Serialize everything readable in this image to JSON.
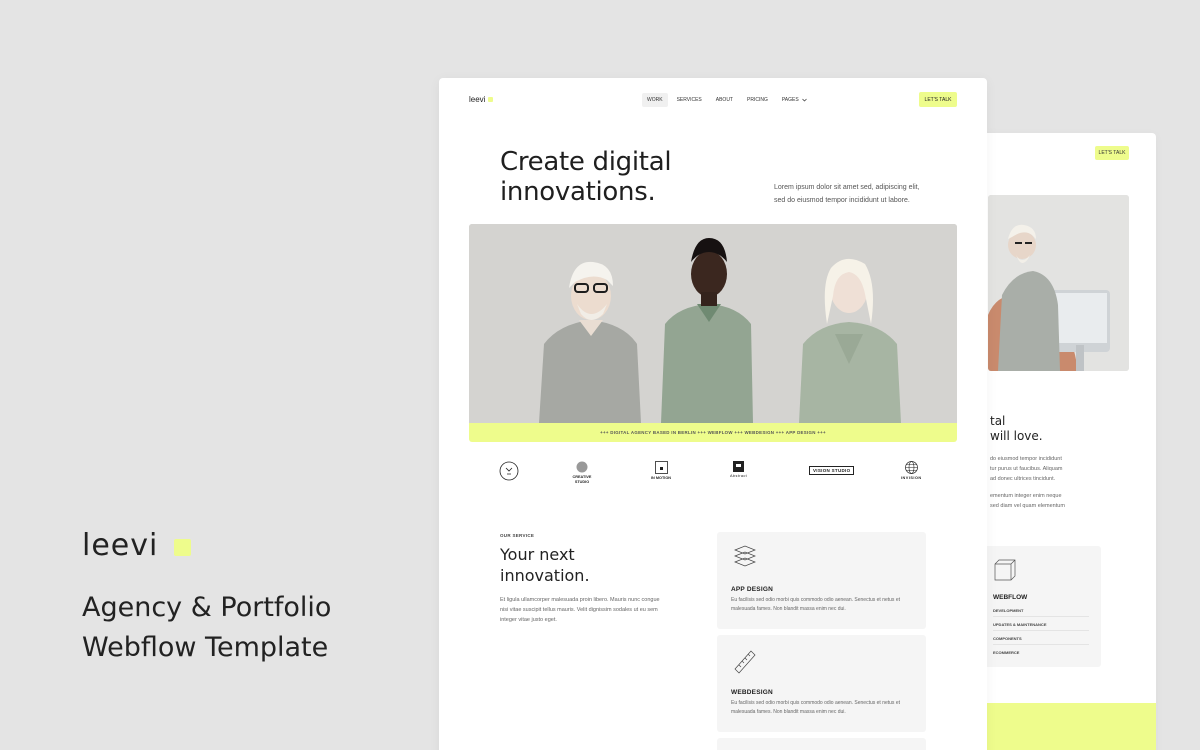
{
  "brand": {
    "name": "leevi",
    "tagline_line1": "Agency & Portfolio",
    "tagline_line2": "Webflow Template",
    "accent_color": "#eefc8c"
  },
  "nav": {
    "logo": "leevi",
    "items": [
      {
        "label": "WORK",
        "active": true
      },
      {
        "label": "SERVICES",
        "active": false
      },
      {
        "label": "ABOUT",
        "active": false
      },
      {
        "label": "PRICING",
        "active": false
      },
      {
        "label": "PAGES",
        "active": false,
        "dropdown": true
      }
    ],
    "cta": "LET'S TALK"
  },
  "hero": {
    "title_line1": "Create digital",
    "title_line2": "innovations.",
    "subtitle_line1": "Lorem ipsum dolor sit amet sed, adipiscing elit,",
    "subtitle_line2": "sed do eiusmod tempor incididunt ut labore.",
    "ticker": "+++ DIGITAL AGENCY BASED IN BERLIN +++ WEBFLOW +++ WEBDESIGN +++ APP DESIGN +++"
  },
  "logos": [
    {
      "label": "",
      "icon": "emblem-icon"
    },
    {
      "label": "CREATIVE STUDIO",
      "icon": "circle-logo-icon"
    },
    {
      "label": "IN MOTION",
      "icon": "square-frame-logo-icon"
    },
    {
      "label": "Abstract",
      "icon": "dark-square-logo-icon"
    },
    {
      "label": "VISION STUDIO",
      "icon": "vision-box-logo-icon"
    },
    {
      "label": "INVISION",
      "icon": "globe-logo-icon"
    }
  ],
  "services": {
    "label": "OUR SERVICE",
    "title_line1": "Your next",
    "title_line2": "innovation.",
    "text": "Et ligula ullamcorper malesuada proin libero. Mauris nunc congue nisi vitae suscipit tellus mauris. Velit dignissim sodales ut eu sem integer vitae justo eget.",
    "cards": [
      {
        "title": "APP DESIGN",
        "icon": "layers-icon",
        "desc": "Eu facilisis sed odio morbi quis commodo odio aenean. Senectus et netus et malesuada fames. Non blandit massa enim nec dui."
      },
      {
        "title": "WEBDESIGN",
        "icon": "ruler-icon",
        "desc": "Eu facilisis sed odio morbi quis commodo odio aenean. Senectus et netus et malesuada fames. Non blandit massa enim nec dui."
      }
    ]
  },
  "back_page": {
    "cta": "LET'S TALK",
    "heading_line1": "tal",
    "heading_line2": "will love.",
    "para1_l1": "do eiusmod tempor incididunt",
    "para1_l2": "tur purus ut faucibus. Aliquam",
    "para1_l3": "ad donec ultrices tincidunt.",
    "para2_l1": "ementum integer enim neque",
    "para2_l2": "sed diam vel quam elementum",
    "card_title": "WEBFLOW",
    "card_items": [
      "DEVELOPMENT",
      "UPDATES & MAINTENANCE",
      "COMPONENTS",
      "ECOMMERCE"
    ]
  }
}
